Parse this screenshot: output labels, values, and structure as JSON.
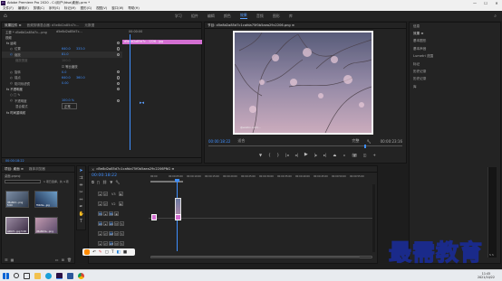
{
  "title_bar": {
    "app": "Adobe Premiere Pro 2020 - C:\\用户\\fdsa\\桌面\\.prm *",
    "minimize": "—",
    "maximize": "☐",
    "close": "✕"
  },
  "menu": [
    "文件(F)",
    "编辑(E)",
    "剪辑(C)",
    "序列(S)",
    "标记(M)",
    "图形(G)",
    "视图(V)",
    "窗口(W)",
    "帮助(H)"
  ],
  "workspaces": [
    {
      "label": "学习",
      "active": false
    },
    {
      "label": "组件",
      "active": false
    },
    {
      "label": "编辑",
      "active": false
    },
    {
      "label": "颜色",
      "active": false
    },
    {
      "label": "效果",
      "active": true
    },
    {
      "label": "音频",
      "active": false
    },
    {
      "label": "图形",
      "active": false
    },
    {
      "label": "库",
      "active": false
    }
  ],
  "effect_controls": {
    "tabs": [
      "效果控件 ≡",
      "音频剪辑混合器: d5e8d2a85d7c...",
      "元数据"
    ],
    "source_label": "主要 * d5e8d2a85d7c...png",
    "sequence_label": "d5e8d2a85d7c...",
    "mini_timecode": "00:00:00",
    "clip_label": "d5e8d2a85d7c...1226...jpg",
    "rows": [
      {
        "name": "视频",
        "val": "",
        "val2": "",
        "indent": 0
      },
      {
        "name": "fx 运动",
        "val": "",
        "val2": "",
        "indent": 1
      },
      {
        "name": "位置",
        "val": "640.0",
        "val2": "333.0",
        "indent": 2
      },
      {
        "name": "缩放",
        "val": "81.0",
        "val2": "",
        "indent": 2
      },
      {
        "name": "缩放宽度",
        "val": "100.0",
        "val2": "",
        "indent": 2
      },
      {
        "name": "",
        "val": "☑ 等比缩放",
        "val2": "",
        "indent": 2
      },
      {
        "name": "旋转",
        "val": "0.0",
        "val2": "",
        "indent": 2
      },
      {
        "name": "锚点",
        "val": "640.0",
        "val2": "360.0",
        "indent": 2
      },
      {
        "name": "防闪烁滤镜",
        "val": "0.00",
        "val2": "",
        "indent": 2
      },
      {
        "name": "fx 不透明度",
        "val": "",
        "val2": "",
        "indent": 1
      },
      {
        "name": "○ □ ✎",
        "val": "",
        "val2": "",
        "indent": 2
      },
      {
        "name": "不透明度",
        "val": "100.0 %",
        "val2": "",
        "indent": 2
      },
      {
        "name": "混合模式",
        "val": "正常",
        "val2": "",
        "indent": 2
      },
      {
        "name": "fx 时间重映射",
        "val": "",
        "val2": "",
        "indent": 1
      }
    ],
    "footer_timecode": "00:00:18:22"
  },
  "program": {
    "tab": "节目: d5e8d2a85d7c1cafda75f0b5aea29c2206.png ≡",
    "timecode": "00:00:18:22",
    "fit": "适合",
    "quality": "完整",
    "duration": "00:00:23:16",
    "watermark": "@weibo.com/..."
  },
  "right_panel": {
    "items": [
      "信息",
      "效果 ≡",
      "基本图形",
      "基本声音",
      "Lumetri 范围",
      "标记",
      "历史记录",
      "历史记录",
      "库"
    ]
  },
  "project": {
    "tabs": [
      "项目: 桌面 ≡",
      "媒体浏览器"
    ],
    "path": "桌面.prproj",
    "count": "1 项已选择，共 4 项",
    "items": [
      {
        "label": "d5e8d2...png 5:00"
      },
      {
        "label": "ffdb8e...jpg"
      },
      {
        "label": "a06c5...jpg 5:00"
      },
      {
        "label": "d5e8d2a...png"
      }
    ]
  },
  "timeline": {
    "tab": "d5e8d2a85d7c1cafda75f0b5aea29c2206PNG ≡",
    "timecode": "00:00:18:22",
    "ruler": [
      "00:00",
      "00:00:05:00",
      "00:00:10:00",
      "00:00:15:00",
      "00:00:20:00",
      "00:00:25:00",
      "00:00:30:00",
      "00:00:35:00",
      "00:00:40:00",
      "00:00:45:00",
      "00:00:50:00",
      "00:00:55:00",
      "00:01:00:00"
    ],
    "tracks": [
      {
        "name": "V3"
      },
      {
        "name": "V2"
      },
      {
        "name": "V1"
      },
      {
        "name": "A1"
      },
      {
        "name": "A2"
      },
      {
        "name": "A3"
      }
    ],
    "master": "主声道",
    "master_val": "0.0"
  },
  "brand_overlay": "最需教育",
  "taskbar": {
    "time": "11:45",
    "date": "2021/10/22"
  }
}
